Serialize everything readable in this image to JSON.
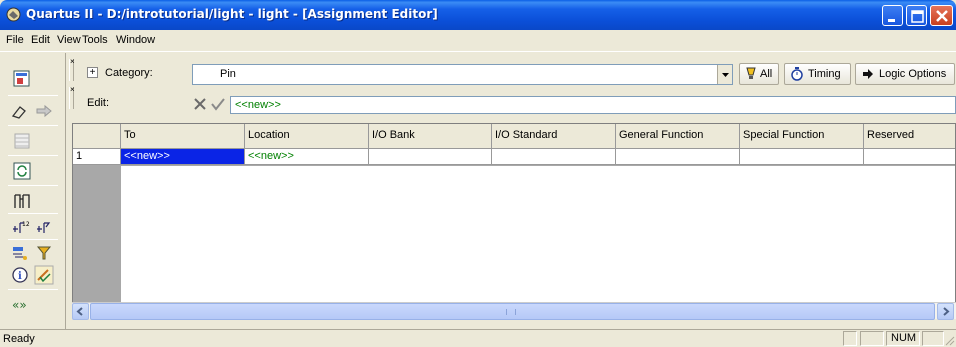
{
  "window": {
    "title": "Quartus II - D:/introtutorial/light - light - [Assignment Editor]"
  },
  "menu": {
    "items": [
      "File",
      "Edit",
      "View",
      "Tools",
      "Window"
    ]
  },
  "toolbar": {
    "category_label": "Category:",
    "category_value": "Pin",
    "all_label": "All",
    "timing_label": "Timing",
    "logic_options_label": "Logic Options",
    "edit_label": "Edit:",
    "edit_value": "<<new>>"
  },
  "grid": {
    "columns": [
      "To",
      "Location",
      "I/O Bank",
      "I/O Standard",
      "General Function",
      "Special Function",
      "Reserved"
    ],
    "rows": [
      {
        "index": "1",
        "cells": [
          "<<new>>",
          "<<new>>",
          "",
          "",
          "",
          "",
          ""
        ]
      }
    ]
  },
  "status": {
    "text": "Ready",
    "num": "NUM"
  },
  "colors": {
    "title_bar": "#0B4FD8",
    "selection": "#0A24E6",
    "new_text": "#008000"
  }
}
